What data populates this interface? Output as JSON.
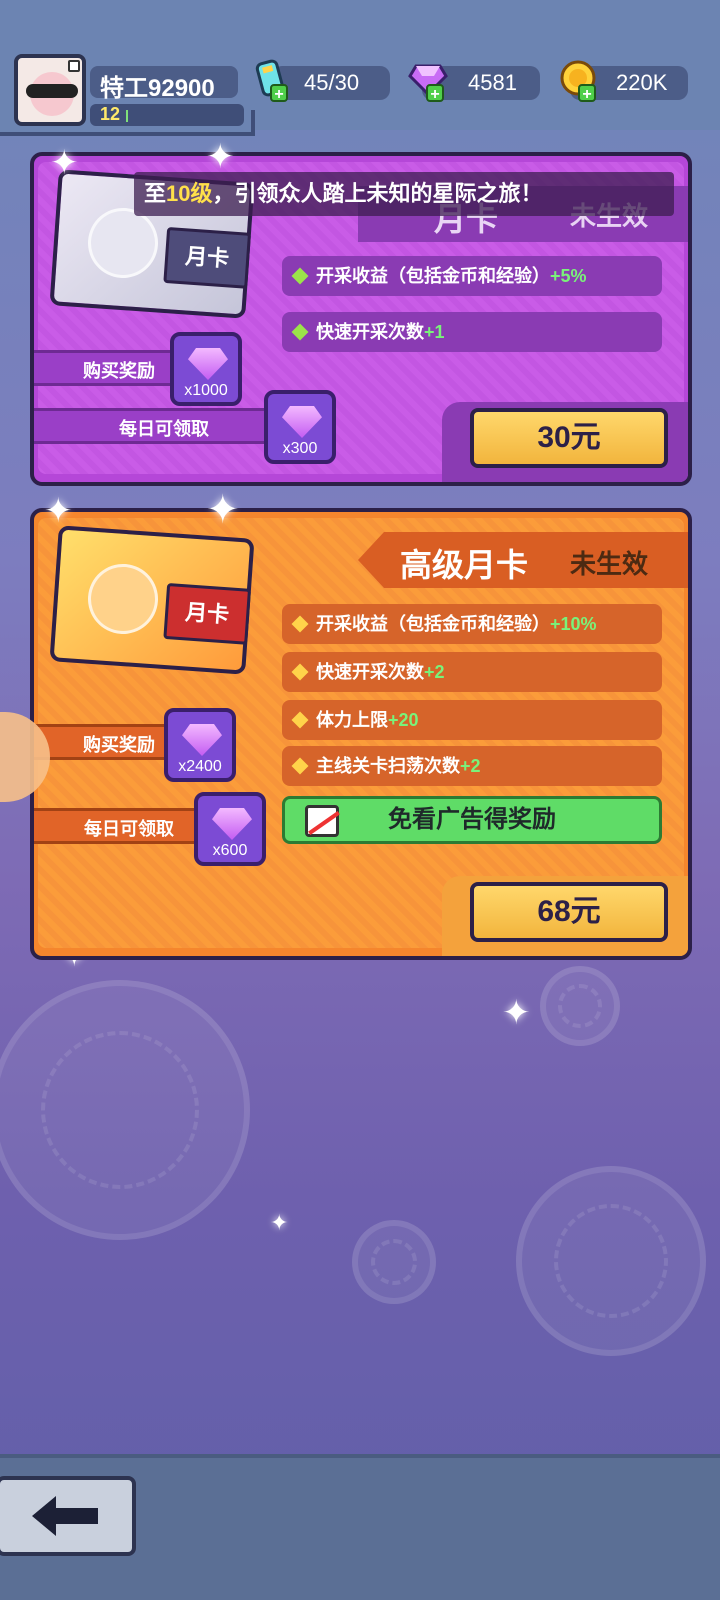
{
  "header": {
    "player_name": "特工92900",
    "level": "12",
    "stamina": "45/30",
    "gems": "4581",
    "gold": "220K"
  },
  "monthly_card": {
    "notice_prefix": "至",
    "notice_level": "10级",
    "notice_suffix": "，引领众人踏上未知的星际之旅！",
    "title": "月卡",
    "status": "未生效",
    "art_label": "月卡",
    "benefits": [
      {
        "text": "开采收益（包括金币和经验）",
        "bonus": "+5%"
      },
      {
        "text": "快速开采次数",
        "bonus": "+1"
      }
    ],
    "purchase_reward_label": "购买奖励",
    "purchase_reward_count": "x1000",
    "daily_label": "每日可领取",
    "daily_count": "x300",
    "price": "30元"
  },
  "premium_card": {
    "title": "高级月卡",
    "status": "未生效",
    "art_label": "月卡",
    "benefits": [
      {
        "text": "开采收益（包括金币和经验）",
        "bonus": "+10%"
      },
      {
        "text": "快速开采次数",
        "bonus": "+2"
      },
      {
        "text": "体力上限",
        "bonus": "+20"
      },
      {
        "text": "主线关卡扫荡次数",
        "bonus": "+2"
      }
    ],
    "no_ad_label": "免看广告得奖励",
    "purchase_reward_label": "购买奖励",
    "purchase_reward_count": "x2400",
    "daily_label": "每日可领取",
    "daily_count": "x600",
    "price": "68元"
  },
  "icons": [
    "avatar",
    "stamina-battery-icon",
    "gem-icon",
    "gold-coin-icon",
    "plus-icon",
    "back-arrow-icon",
    "no-ad-icon"
  ]
}
